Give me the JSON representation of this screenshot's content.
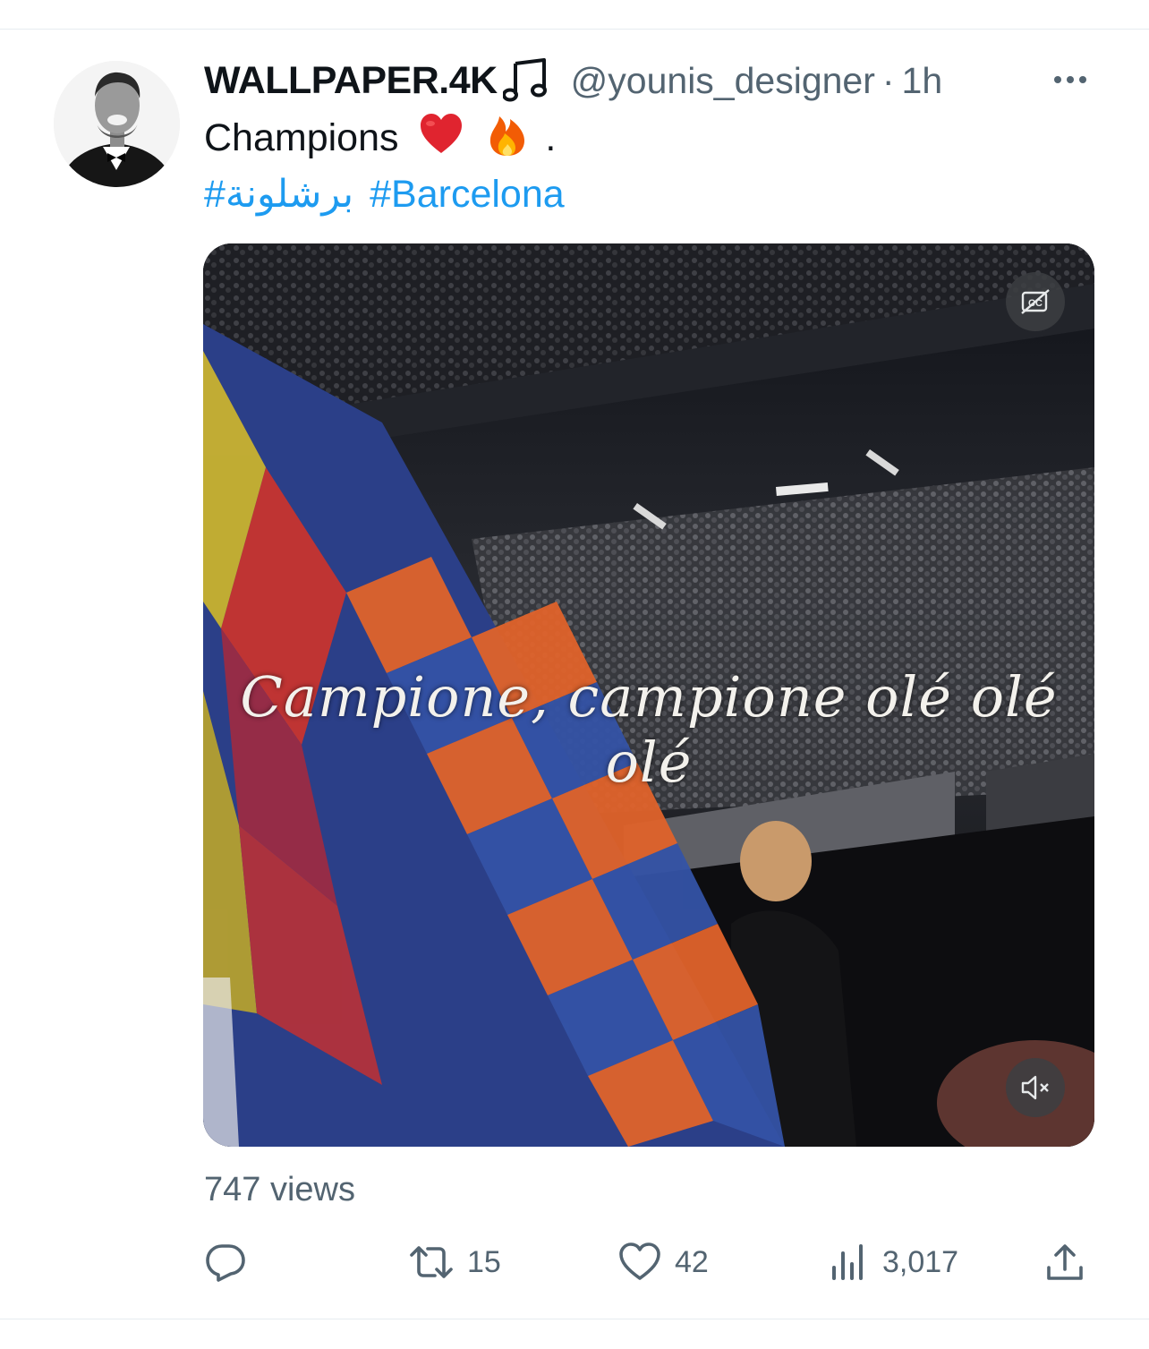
{
  "tweet": {
    "display_name": "WALLPAPER.4K",
    "handle": "@younis_designer",
    "separator": "·",
    "time": "1h",
    "text": "Champions",
    "text_end": ".",
    "hashtags": [
      "#برشلونة",
      "#Barcelona"
    ],
    "media": {
      "caption": "Campione, campione olé olé olé"
    },
    "views": "747 views",
    "stats": {
      "retweets": "15",
      "likes": "42",
      "analytics": "3,017"
    }
  },
  "icons": {
    "name_badge": "music-note-icon",
    "more": "more-dots-icon",
    "emoji_1": "red-heart-emoji",
    "emoji_2": "fire-emoji",
    "cc": "closed-captions-icon",
    "mute": "muted-speaker-icon",
    "reply": "reply-icon",
    "retweet": "retweet-icon",
    "like": "heart-icon",
    "analytics": "bar-chart-icon",
    "share": "share-icon"
  },
  "colors": {
    "link": "#1d9bf0",
    "secondary_text": "#536471",
    "primary_text": "#0f1419"
  }
}
